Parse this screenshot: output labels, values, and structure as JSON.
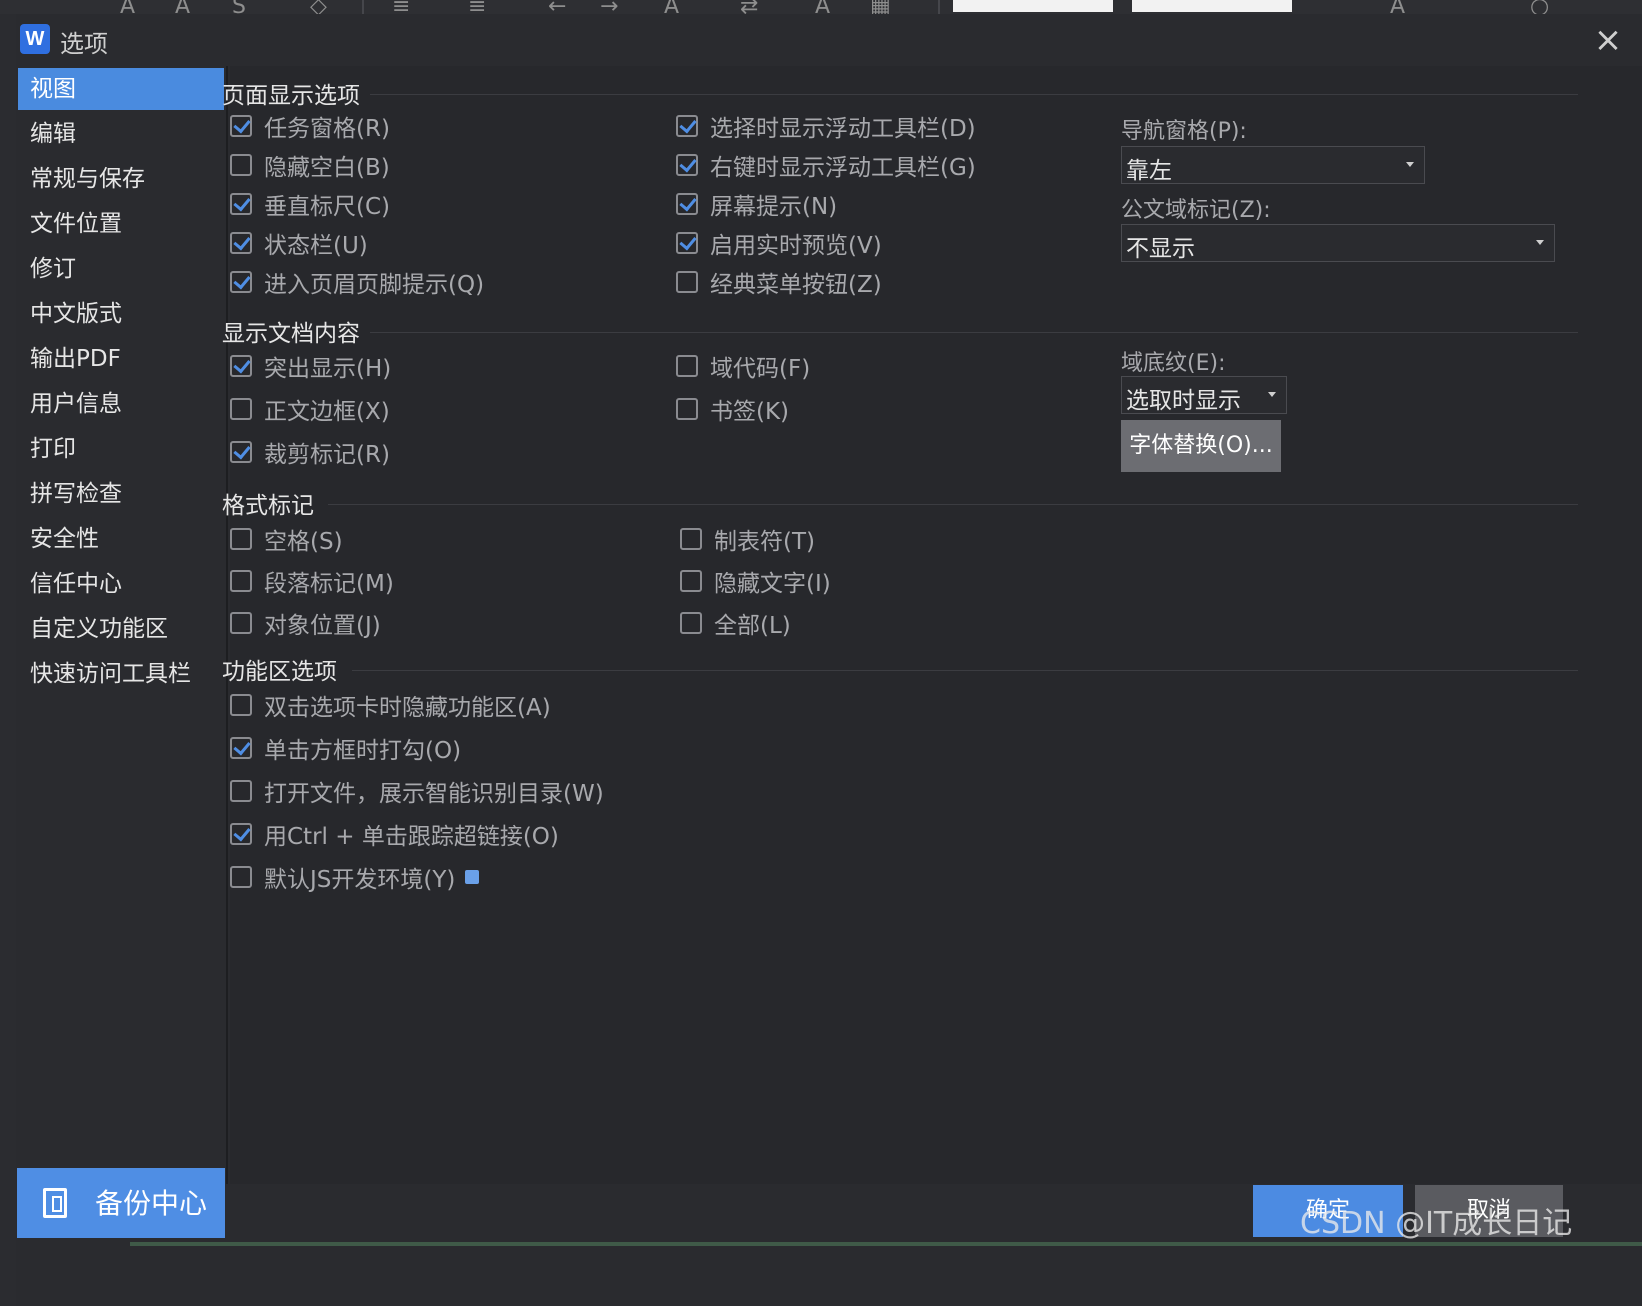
{
  "dialog": {
    "title": "选项",
    "app_logo": "W",
    "close_icon": "×"
  },
  "sidebar": {
    "items": [
      {
        "label": "视图",
        "active": true
      },
      {
        "label": "编辑"
      },
      {
        "label": "常规与保存"
      },
      {
        "label": "文件位置"
      },
      {
        "label": "修订"
      },
      {
        "label": "中文版式"
      },
      {
        "label": "输出PDF"
      },
      {
        "label": "用户信息"
      },
      {
        "label": "打印"
      },
      {
        "label": "拼写检查"
      },
      {
        "label": "安全性"
      },
      {
        "label": "信任中心"
      },
      {
        "label": "自定义功能区"
      },
      {
        "label": "快速访问工具栏"
      }
    ],
    "backup_center": "备份中心"
  },
  "page_display": {
    "title": "页面显示选项",
    "options": [
      {
        "label": "任务窗格(R)",
        "checked": true
      },
      {
        "label": "隐藏空白(B)",
        "checked": false
      },
      {
        "label": "垂直标尺(C)",
        "checked": true
      },
      {
        "label": "状态栏(U)",
        "checked": true
      },
      {
        "label": "进入页眉页脚提示(Q)",
        "checked": true
      },
      {
        "label": "选择时显示浮动工具栏(D)",
        "checked": true
      },
      {
        "label": "右键时显示浮动工具栏(G)",
        "checked": true
      },
      {
        "label": "屏幕提示(N)",
        "checked": true
      },
      {
        "label": "启用实时预览(V)",
        "checked": true
      },
      {
        "label": "经典菜单按钮(Z)",
        "checked": false
      }
    ],
    "nav_pane_label": "导航窗格(P):",
    "nav_pane_value": "靠左",
    "doc_field_label": "公文域标记(Z):",
    "doc_field_value": "不显示"
  },
  "doc_content": {
    "title": "显示文档内容",
    "options": [
      {
        "label": "突出显示(H)",
        "checked": true
      },
      {
        "label": "正文边框(X)",
        "checked": false
      },
      {
        "label": "裁剪标记(R)",
        "checked": true
      },
      {
        "label": "域代码(F)",
        "checked": false
      },
      {
        "label": "书签(K)",
        "checked": false
      }
    ],
    "field_shading_label": "域底纹(E):",
    "field_shading_value": "选取时显示",
    "font_replace_button": "字体替换(O)..."
  },
  "format_marks": {
    "title": "格式标记",
    "options": [
      {
        "label": "空格(S)",
        "checked": false
      },
      {
        "label": "段落标记(M)",
        "checked": false
      },
      {
        "label": "对象位置(J)",
        "checked": false
      },
      {
        "label": "制表符(T)",
        "checked": false
      },
      {
        "label": "隐藏文字(I)",
        "checked": false
      },
      {
        "label": "全部(L)",
        "checked": false
      }
    ]
  },
  "ribbon": {
    "title": "功能区选项",
    "options": [
      {
        "label": "双击选项卡时隐藏功能区(A)",
        "checked": false
      },
      {
        "label": "单击方框时打勾(O)",
        "checked": true
      },
      {
        "label": "打开文件，展示智能识别目录(W)",
        "checked": false
      },
      {
        "label": "用Ctrl + 单击跟踪超链接(O)",
        "checked": true
      },
      {
        "label": "默认JS开发环境(Y)",
        "checked": false
      }
    ]
  },
  "footer": {
    "ok": "确定",
    "cancel": "取消",
    "watermark": "CSDN @IT成长日记"
  },
  "colors": {
    "accent": "#4f8ee4",
    "background": "#27282c",
    "sidebar_active": "#4a8bdf"
  }
}
